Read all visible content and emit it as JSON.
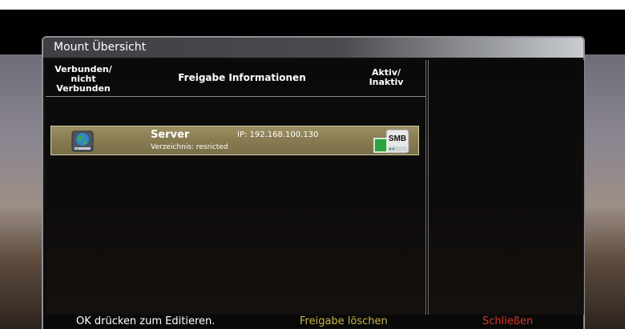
{
  "window": {
    "title": "Mount Übersicht"
  },
  "table": {
    "headers": {
      "connected": "Verbunden/\nnicht\nVerbunden",
      "share_info": "Freigabe Informationen",
      "active": "Aktiv/\nInaktiv"
    },
    "rows": [
      {
        "name": "Server",
        "ip": "IP: 192.168.100.130",
        "directory": "Verzeichnis: resricted",
        "status_icon": "network-drive-globe-icon",
        "type_icon": "smb-drive-icon",
        "type_label": "SMB",
        "selected": true
      }
    ]
  },
  "footer": {
    "ok_hint": "OK drücken zum Editieren.",
    "yellow_action": "Freigabe löschen",
    "red_action": "Schließen"
  },
  "colors": {
    "selection": "#8a7e55",
    "yellow_key": "#c9b44a",
    "red_key": "#d9362c"
  }
}
